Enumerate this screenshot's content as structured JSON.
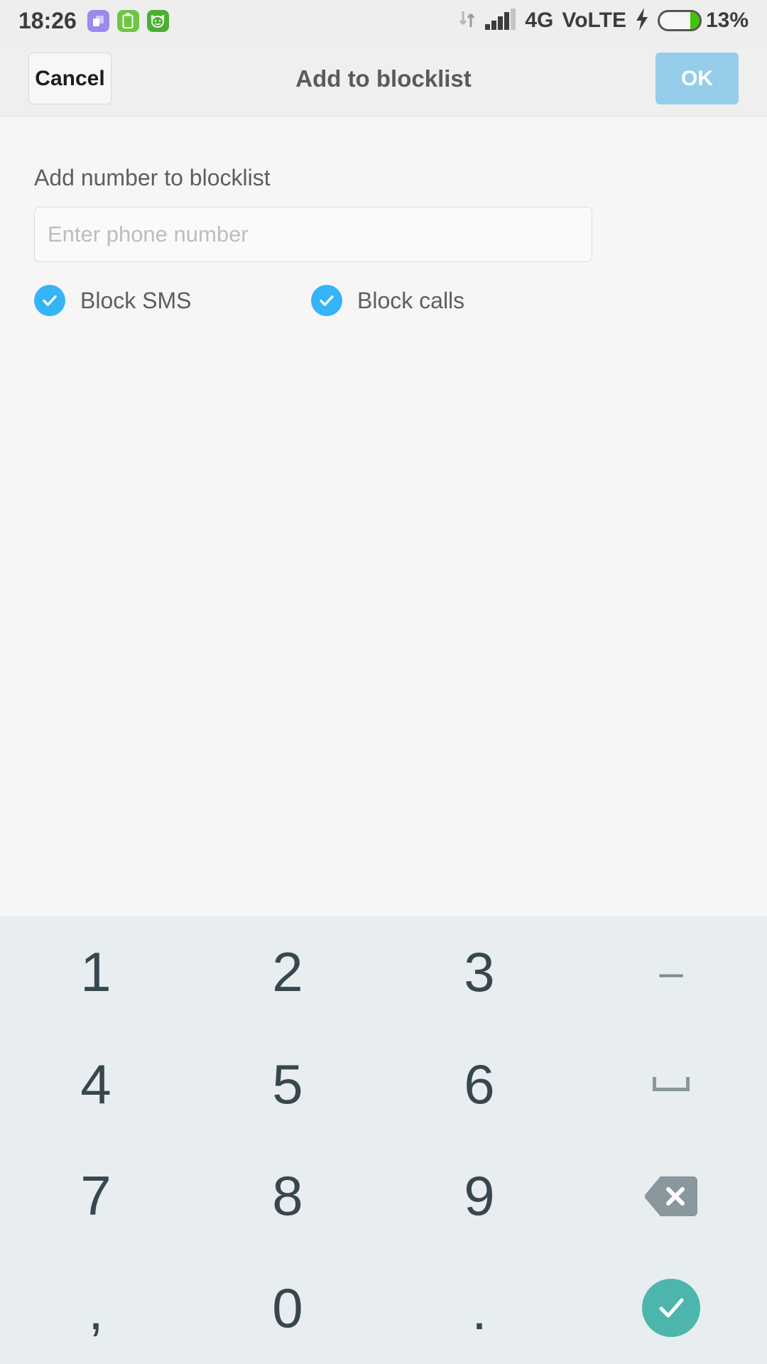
{
  "status_bar": {
    "clock": "18:26",
    "app_icons": [
      {
        "name": "multiwindow-icon",
        "color": "#9b8aeb"
      },
      {
        "name": "battery-saver-icon",
        "color": "#6fc544"
      },
      {
        "name": "security-cat-icon",
        "color": "#4caf32"
      }
    ],
    "data_transfer_label": "data-transfer-icon",
    "signal_label": "signal-bars-icon",
    "network": "4G",
    "volte": "VoLTE",
    "charging_label": "charging-bolt-icon",
    "battery_percent": "13%",
    "battery_fill_color": "#3fc40a"
  },
  "title_bar": {
    "cancel_label": "Cancel",
    "title": "Add to blocklist",
    "ok_label": "OK",
    "ok_color": "#96cdeb"
  },
  "content": {
    "section_label": "Add number to blocklist",
    "phone_input": {
      "value": "",
      "placeholder": "Enter phone number"
    },
    "checkboxes": [
      {
        "label": "Block SMS",
        "checked": true,
        "color": "#35b4f7"
      },
      {
        "label": "Block calls",
        "checked": true,
        "color": "#35b4f7"
      }
    ]
  },
  "keypad": {
    "background": "#e8edef",
    "key_color": "#37474f",
    "enter_color": "#4db6ac",
    "backspace_color": "#8a979d",
    "rows": [
      [
        "1",
        "2",
        "3",
        "–"
      ],
      [
        "4",
        "5",
        "6",
        "space"
      ],
      [
        "7",
        "8",
        "9",
        "backspace"
      ],
      [
        ",",
        "0",
        ".",
        "enter"
      ]
    ]
  }
}
